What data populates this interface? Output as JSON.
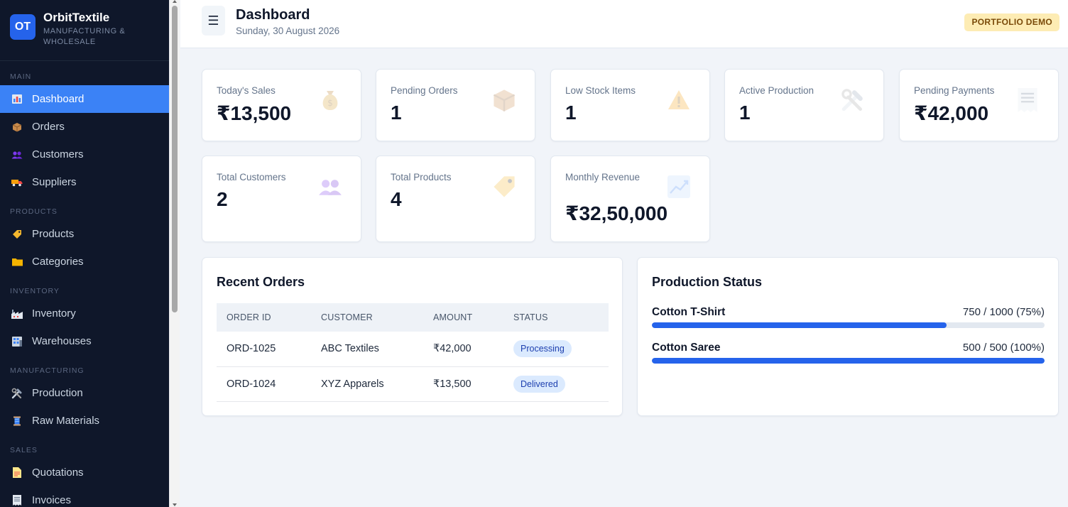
{
  "brand": {
    "logo": "OT",
    "name": "OrbitTextile",
    "subtitle": "Manufacturing & Wholesale"
  },
  "sidebar": {
    "sections": [
      {
        "title": "Main",
        "items": [
          {
            "label": "Dashboard",
            "icon": "bar-chart-icon",
            "active": true
          },
          {
            "label": "Orders",
            "icon": "package-icon"
          },
          {
            "label": "Customers",
            "icon": "users-icon"
          },
          {
            "label": "Suppliers",
            "icon": "truck-icon"
          }
        ]
      },
      {
        "title": "Products",
        "items": [
          {
            "label": "Products",
            "icon": "tag-icon"
          },
          {
            "label": "Categories",
            "icon": "folder-icon"
          }
        ]
      },
      {
        "title": "Inventory",
        "items": [
          {
            "label": "Inventory",
            "icon": "factory-icon"
          },
          {
            "label": "Warehouses",
            "icon": "building-icon"
          }
        ]
      },
      {
        "title": "Manufacturing",
        "items": [
          {
            "label": "Production",
            "icon": "tools-icon"
          },
          {
            "label": "Raw Materials",
            "icon": "thread-icon"
          }
        ]
      },
      {
        "title": "Sales",
        "items": [
          {
            "label": "Quotations",
            "icon": "document-icon"
          },
          {
            "label": "Invoices",
            "icon": "receipt-icon"
          }
        ]
      }
    ]
  },
  "header": {
    "menu_icon": "☰",
    "title": "Dashboard",
    "date": "Sunday, 30 August 2026",
    "badge": "PORTFOLIO DEMO"
  },
  "stats": [
    {
      "label": "Today's Sales",
      "value": "₹13,500",
      "icon": "money-bag-icon"
    },
    {
      "label": "Pending Orders",
      "value": "1",
      "icon": "package-icon"
    },
    {
      "label": "Low Stock Items",
      "value": "1",
      "icon": "warning-icon"
    },
    {
      "label": "Active Production",
      "value": "1",
      "icon": "tools-icon"
    },
    {
      "label": "Pending Payments",
      "value": "₹42,000",
      "icon": "receipt-icon"
    },
    {
      "label": "Total Customers",
      "value": "2",
      "icon": "users-icon"
    },
    {
      "label": "Total Products",
      "value": "4",
      "icon": "tag-icon"
    },
    {
      "label": "Monthly Revenue",
      "value": "₹32,50,000",
      "icon": "chart-up-icon"
    }
  ],
  "recent_orders": {
    "title": "Recent Orders",
    "columns": [
      "Order ID",
      "Customer",
      "Amount",
      "Status"
    ],
    "rows": [
      {
        "id": "ORD-1025",
        "customer": "ABC Textiles",
        "amount": "₹42,000",
        "status": "Processing"
      },
      {
        "id": "ORD-1024",
        "customer": "XYZ Apparels",
        "amount": "₹13,500",
        "status": "Delivered"
      }
    ]
  },
  "production_status": {
    "title": "Production Status",
    "items": [
      {
        "name": "Cotton T-Shirt",
        "count": "750 / 1000 (75%)",
        "progress": 0.75
      },
      {
        "name": "Cotton Saree",
        "count": "500 / 500 (100%)",
        "progress": 1.0
      }
    ]
  },
  "colors": {
    "sidebar_bg": "#0f172a",
    "accent": "#3b82f6",
    "progress": "#2563eb",
    "badge_bg": "#fdecb4"
  }
}
